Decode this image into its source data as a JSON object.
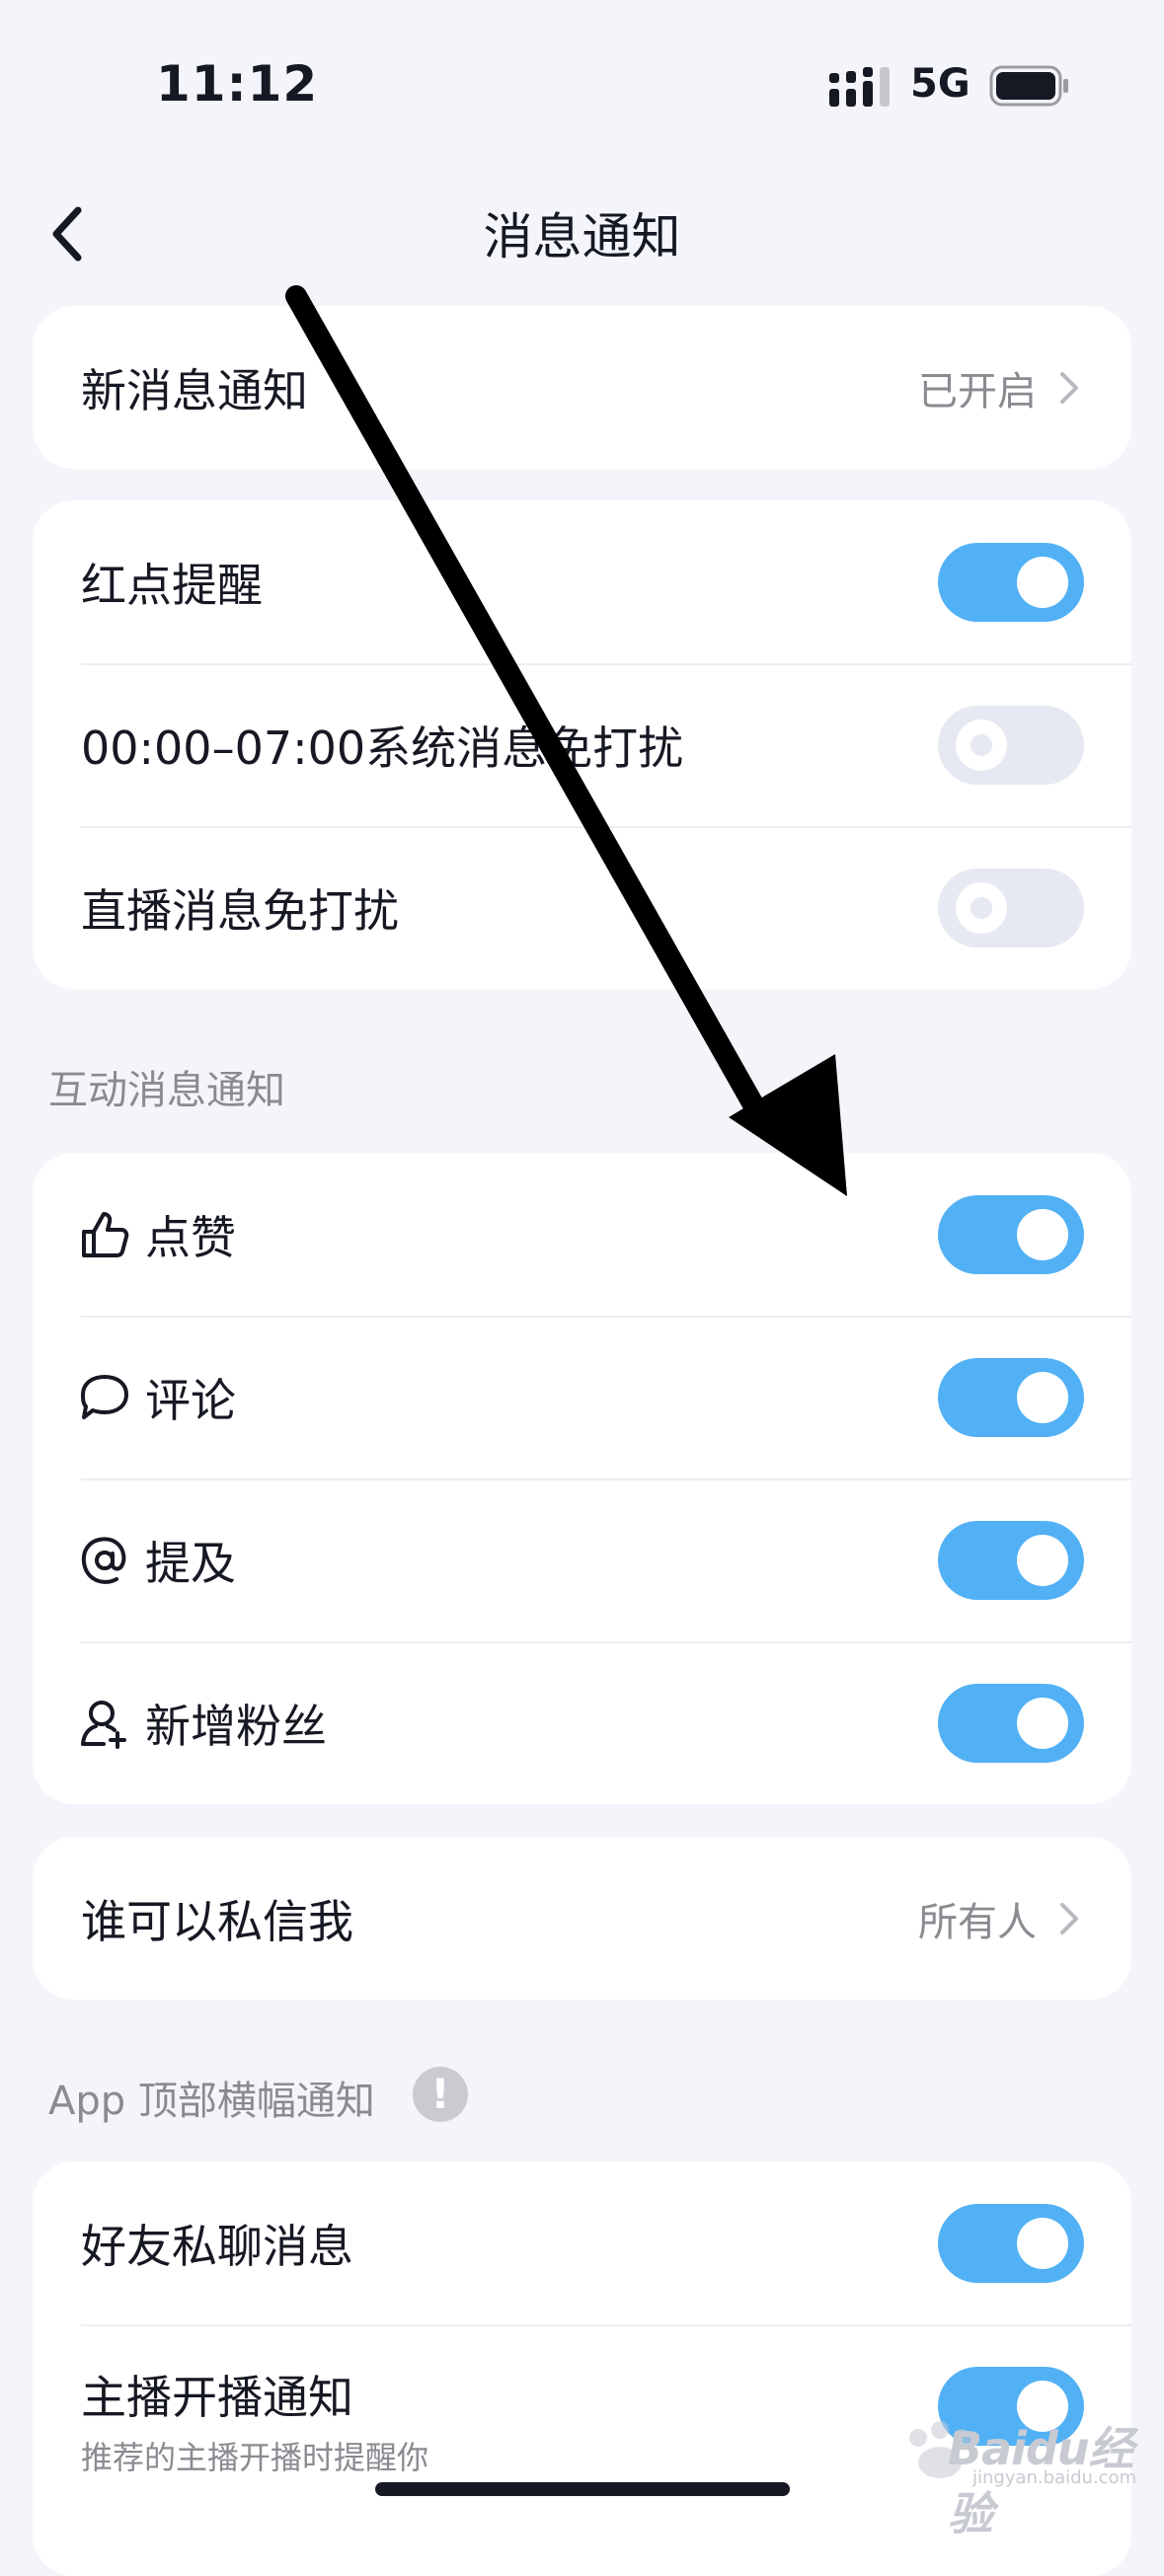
{
  "status_bar": {
    "time": "11:12",
    "network": "5G"
  },
  "nav": {
    "title": "消息通知"
  },
  "new_message_card": {
    "label": "新消息通知",
    "value": "已开启"
  },
  "reminder_card": {
    "items": [
      {
        "label": "红点提醒",
        "state": "on"
      },
      {
        "label": "00:00–07:00系统消息免打扰",
        "state": "off"
      },
      {
        "label": "直播消息免打扰",
        "state": "off"
      }
    ]
  },
  "interaction_section": {
    "header": "互动消息通知",
    "items": [
      {
        "label": "点赞",
        "icon": "thumbs-up-icon",
        "state": "on"
      },
      {
        "label": "评论",
        "icon": "comment-icon",
        "state": "on"
      },
      {
        "label": "提及",
        "icon": "at-icon",
        "state": "on"
      },
      {
        "label": "新增粉丝",
        "icon": "add-follower-icon",
        "state": "on"
      }
    ]
  },
  "private_message_card": {
    "label": "谁可以私信我",
    "value": "所有人"
  },
  "banner_section": {
    "header": "App 顶部横幅通知",
    "info_icon_text": "!",
    "items": [
      {
        "label": "好友私聊消息",
        "state": "on"
      },
      {
        "label": "主播开播通知",
        "subtitle": "推荐的主播开播时提醒你",
        "state": "on"
      }
    ]
  },
  "watermark": {
    "text": "Baidu经验",
    "subtext": "jingyan.baidu.com"
  },
  "colors": {
    "background": "#f4f5fa",
    "card": "#ffffff",
    "toggle_on": "#52b1f5",
    "toggle_off": "#e6e8f2",
    "secondary_text": "#8a8b91",
    "arrow": "#000000"
  }
}
